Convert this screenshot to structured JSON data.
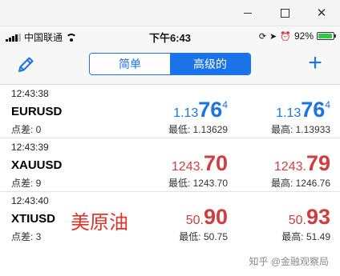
{
  "window": {
    "controls": {
      "minimize_icon": "minimize-icon",
      "maximize_icon": "maximize-icon",
      "close_icon": "close-icon"
    }
  },
  "status_bar": {
    "carrier": "中国联通",
    "time": "下午6:43",
    "battery_percent_text": "92%",
    "battery_level": 0.92,
    "icons": [
      "signal-icon",
      "wifi-icon",
      "screen-lock-icon",
      "location-icon",
      "alarm-icon",
      "battery-icon"
    ]
  },
  "toolbar": {
    "segments": [
      {
        "label": "简单",
        "active": false
      },
      {
        "label": "高级的",
        "active": true
      }
    ],
    "accent_color": "#1a73e8"
  },
  "quotes": [
    {
      "time": "12:43:38",
      "symbol": "EURUSD",
      "spread": "点差: 0",
      "color": "blue",
      "bid": {
        "prefix": "1.13",
        "big": "76",
        "sup": "4"
      },
      "ask": {
        "prefix": "1.13",
        "big": "76",
        "sup": "4"
      },
      "low": "最低: 1.13629",
      "high": "最高: 1.13933"
    },
    {
      "time": "12:43:39",
      "symbol": "XAUUSD",
      "spread": "点差: 9",
      "color": "red",
      "bid": {
        "prefix": "1243.",
        "big": "70",
        "sup": ""
      },
      "ask": {
        "prefix": "1243.",
        "big": "79",
        "sup": ""
      },
      "low": "最低: 1243.70",
      "high": "最高: 1246.76"
    },
    {
      "time": "12:43:40",
      "symbol": "XTIUSD",
      "spread": "点差: 3",
      "color": "red",
      "bid": {
        "prefix": "50.",
        "big": "90",
        "sup": ""
      },
      "ask": {
        "prefix": "50.",
        "big": "93",
        "sup": ""
      },
      "low": "最低: 50.75",
      "high": "最高: 51.49"
    }
  ],
  "overlay_label": "美原油",
  "watermark": "知乎 @金融观察局",
  "colors": {
    "up": "#1a73e8",
    "down": "#d23c3c",
    "annotation": "#e0342a"
  }
}
